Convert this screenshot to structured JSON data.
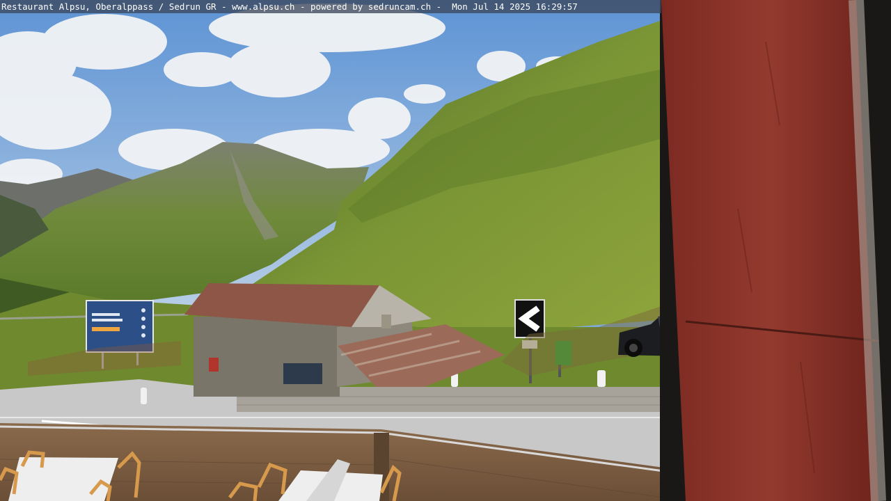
{
  "caption": {
    "text": "Restaurant Alpsu, Oberalppass / Sedrun GR - www.alpsu.ch - powered by sedruncam.ch -  Mon Jul 14 2025 16:29:57"
  },
  "scene": {
    "description_colors": {
      "sky": "#7fa9d8",
      "meadow": "#6f8a2e",
      "road": "#c9c9c9",
      "roof_rust": "#8e4f3e",
      "pillar_red": "#8a2a22"
    },
    "icons": [
      "chevron-left-road-sign",
      "green-trash-bin",
      "billboard-sign",
      "parked-car"
    ]
  }
}
